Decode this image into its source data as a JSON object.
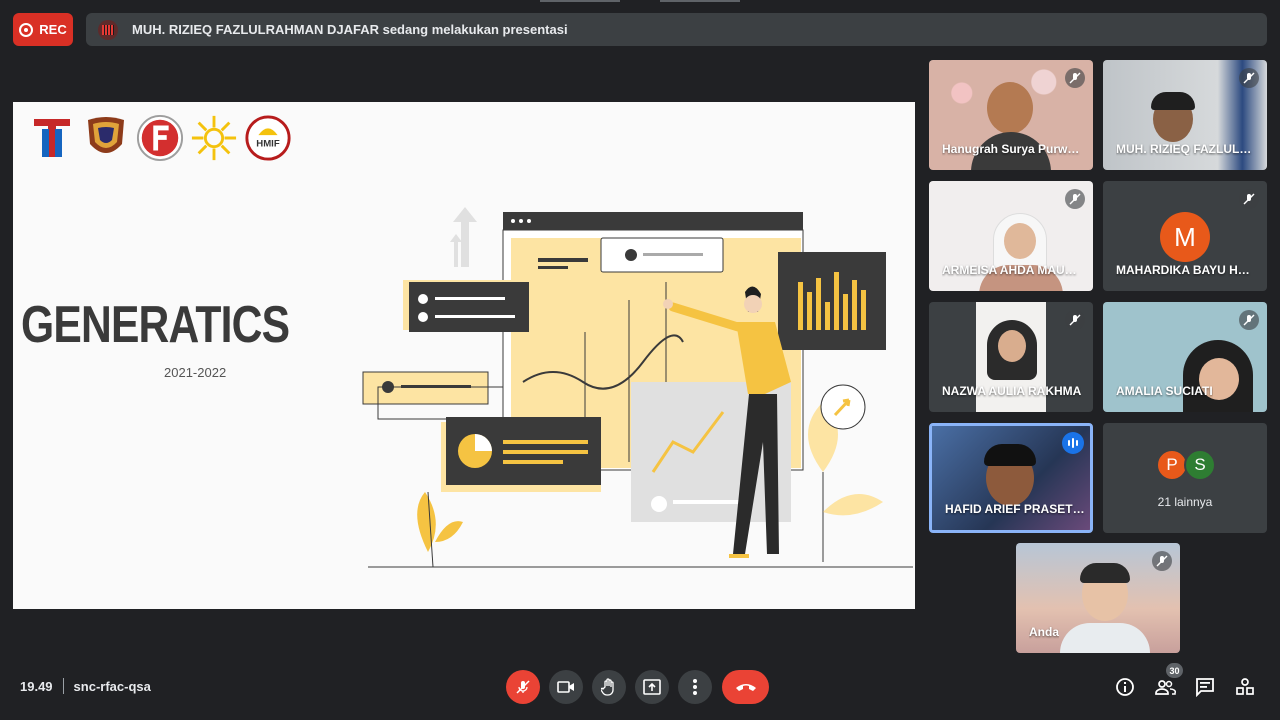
{
  "recording": {
    "label": "REC"
  },
  "banner": {
    "text": "MUH. RIZIEQ FAZLULRAHMAN DJAFAR sedang melakukan presentasi"
  },
  "slide": {
    "logo_text": "HMIF",
    "title": "GENERATICS",
    "years": "2021-2022"
  },
  "participants": [
    {
      "name": "Hanugrah Surya Purwa...",
      "muted": true
    },
    {
      "name": "MUH. RIZIEQ FAZLULR...",
      "muted": true
    },
    {
      "name": "ARMEISA AHDA MAULI...",
      "muted": true
    },
    {
      "name": "MAHARDIKA BAYU HER...",
      "muted": true,
      "avatar_letter": "M"
    },
    {
      "name": "NAZWA AULIA RAKHMA",
      "muted": true
    },
    {
      "name": "AMALIA SUCIATI",
      "muted": true
    },
    {
      "name": "HAFID ARIEF PRASETY...",
      "speaking": true
    },
    {
      "name": "Anda",
      "muted": true
    }
  ],
  "others": {
    "avatars": [
      "P",
      "S"
    ],
    "label": "21 lainnya"
  },
  "meeting": {
    "time": "19.49",
    "code": "snc-rfac-qsa"
  },
  "people_count": "30",
  "colors": {
    "accent_red": "#ea4335",
    "speaking_blue": "#1a73e8",
    "active_border": "#8ab4f8",
    "slide_yellow": "#f5c342",
    "avatar_orange": "#e8591a",
    "avatar_green": "#2e7d32"
  },
  "controls": [
    "mic-off-icon",
    "camera-icon",
    "raise-hand-icon",
    "present-icon",
    "more-icon",
    "end-call-icon"
  ],
  "right_controls": [
    "info-icon",
    "people-icon",
    "chat-icon",
    "activities-icon"
  ]
}
